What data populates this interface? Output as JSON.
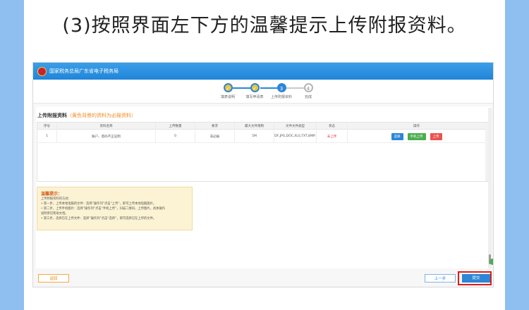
{
  "headline": "(3)按照界面左下方的温馨提示上传附报资料。",
  "portal": {
    "title": "国家税务总局广东省电子税务局"
  },
  "steps": [
    {
      "label": "填表说明",
      "state": "done",
      "mark": "✓"
    },
    {
      "label": "填写申请表",
      "state": "done",
      "mark": "✓"
    },
    {
      "label": "上传附报资料",
      "state": "current",
      "mark": "3"
    },
    {
      "label": "完成",
      "state": "todo",
      "mark": "4"
    }
  ],
  "attachments": {
    "title": "上传附报资料",
    "note": "（黄色背景的资料为必报资料）",
    "columns": [
      "序号",
      "资料名称",
      "上传数量",
      "要求",
      "最大文件限制",
      "文件文件类型",
      "状态",
      "操作"
    ],
    "rows": [
      {
        "index": "1",
        "name": "账户、密码不正证明",
        "count": "0",
        "requirement": "非必报",
        "max_size": "5M",
        "file_types": "PDF,JPG,DOC,XLS,TXT,BMP...",
        "status": "未上传",
        "actions": [
          "选择",
          "手机上传",
          "上传"
        ]
      }
    ]
  },
  "tips": {
    "title": "温馨提示：",
    "lines": [
      "上传附报资料的方式：",
      "• 第一步，上传本地电脑的文件：选择“操作列”点击“上传”，即可上传本地电脑图片。",
      "• 第二步，上传手机图片：选择“操作列”点击“手机上传”，扫描二维码，上传图片。具体操作",
      "  说明参见帮助文档。",
      "• 第三步，选择已在上传文件：选择“操作列”点击“选择”，即可选择已在上传的文件。"
    ]
  },
  "footer": {
    "back": "返回",
    "prev": "上一步",
    "submit": "提交"
  }
}
